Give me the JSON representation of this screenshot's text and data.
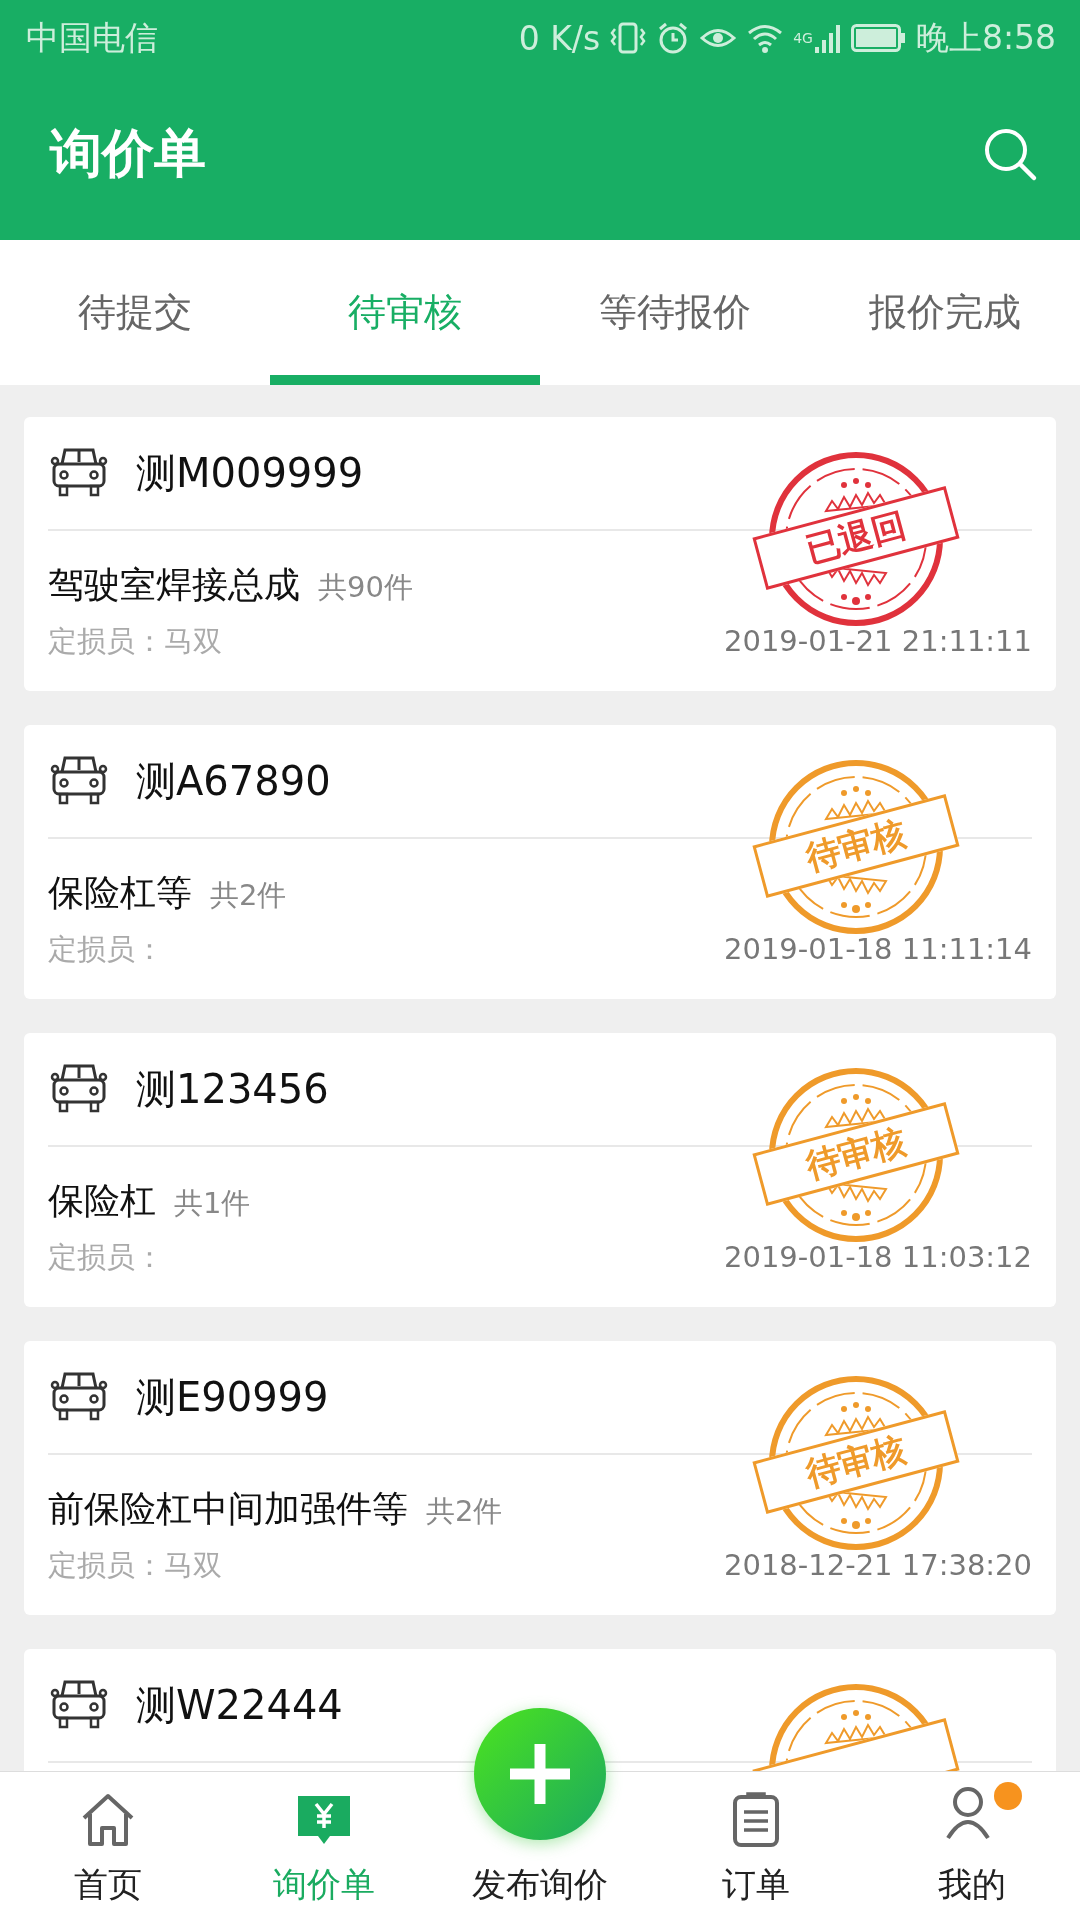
{
  "status_bar": {
    "carrier": "中国电信",
    "speed": "0 K/s",
    "network": "4G",
    "time": "晚上8:58"
  },
  "header": {
    "title": "询价单"
  },
  "tabs": [
    {
      "label": "待提交",
      "selected": false
    },
    {
      "label": "待审核",
      "selected": true
    },
    {
      "label": "等待报价",
      "selected": false
    },
    {
      "label": "报价完成",
      "selected": false
    }
  ],
  "cards": [
    {
      "plate": "测M009999",
      "part": "驾驶室焊接总成",
      "count": "共90件",
      "assessor": "定损员：马双",
      "time": "2019-01-21 21:11:11",
      "stamp": {
        "kind": "returned",
        "label": "已退回"
      }
    },
    {
      "plate": "测A67890",
      "part": "保险杠等",
      "count": "共2件",
      "assessor": "定损员：",
      "time": "2019-01-18 11:11:14",
      "stamp": {
        "kind": "pending",
        "label": "待审核"
      }
    },
    {
      "plate": "测123456",
      "part": "保险杠",
      "count": "共1件",
      "assessor": "定损员：",
      "time": "2019-01-18 11:03:12",
      "stamp": {
        "kind": "pending",
        "label": "待审核"
      }
    },
    {
      "plate": "测E90999",
      "part": "前保险杠中间加强件等",
      "count": "共2件",
      "assessor": "定损员：马双",
      "time": "2018-12-21 17:38:20",
      "stamp": {
        "kind": "pending",
        "label": "待审核"
      }
    },
    {
      "plate": "测W22444",
      "stamp": {
        "kind": "pending"
      }
    }
  ],
  "nav": [
    {
      "kind": "home",
      "label": "首页",
      "selected": false
    },
    {
      "kind": "quote",
      "label": "询价单",
      "selected": true
    },
    {
      "kind": "add",
      "label": "发布询价",
      "selected": false
    },
    {
      "kind": "orders",
      "label": "订单",
      "selected": false
    },
    {
      "kind": "me",
      "label": "我的",
      "selected": false,
      "notice": true
    }
  ]
}
